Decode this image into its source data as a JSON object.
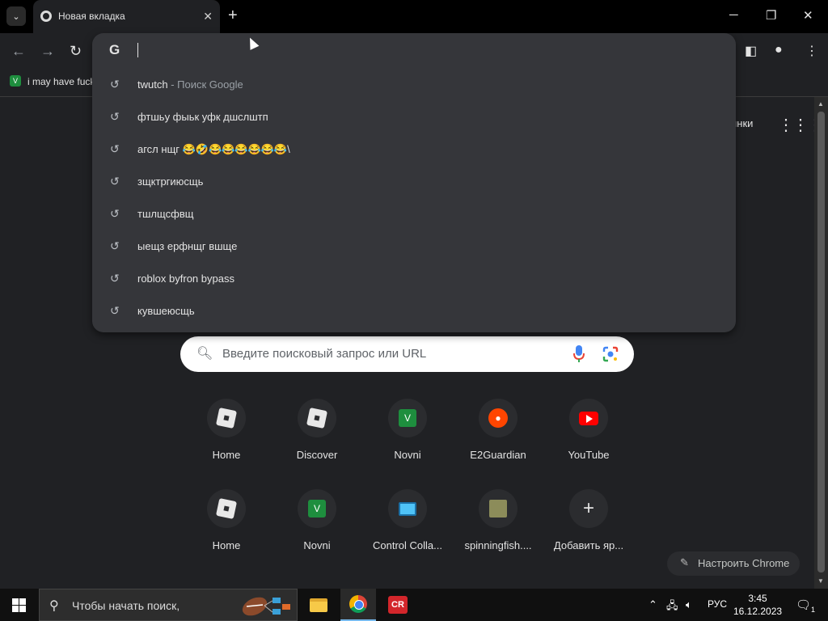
{
  "browser": {
    "tab_title": "Новая вкладка",
    "tab_close": "✕",
    "new_tab": "+",
    "window": {
      "minimize": "─",
      "restore": "❐",
      "close": "✕"
    }
  },
  "toolbar": {
    "back": "←",
    "forward": "→",
    "reload": "↻",
    "sidepanel": "◧",
    "profile": "●",
    "menu": "⋮"
  },
  "bookmarks": [
    {
      "label": "i may have fuck"
    }
  ],
  "omnibox": {
    "engine_icon": "G",
    "suggestions": [
      {
        "text": "twutch",
        "sub": " - Поиск Google"
      },
      {
        "text": "фтшьу фыьк уфк дшслштп",
        "sub": ""
      },
      {
        "text": "агсл нщг 😂🤣😂😂😂😂😂😂\\",
        "sub": ""
      },
      {
        "text": "зщктргиюсщь",
        "sub": ""
      },
      {
        "text": "тшлщсфвщ",
        "sub": ""
      },
      {
        "text": "ыещз ерфнщг вшще",
        "sub": ""
      },
      {
        "text": "roblox byfron bypass",
        "sub": ""
      },
      {
        "text": "кувшеюсщь",
        "sub": ""
      }
    ]
  },
  "ntp": {
    "images_link": "инки",
    "search_placeholder": "Введите поисковый запрос или URL",
    "shortcuts": [
      {
        "label": "Home",
        "icon": "roblox-icon"
      },
      {
        "label": "Discover",
        "icon": "roblox-icon"
      },
      {
        "label": "Novni",
        "icon": "novni-icon"
      },
      {
        "label": "E2Guardian",
        "icon": "reddit-icon"
      },
      {
        "label": "YouTube",
        "icon": "youtube-icon"
      },
      {
        "label": "Home",
        "icon": "roblox-icon"
      },
      {
        "label": "Novni",
        "icon": "novni-icon"
      },
      {
        "label": "Control Colla...",
        "icon": "monitor-icon"
      },
      {
        "label": "spinningfish....",
        "icon": "fish-icon"
      },
      {
        "label": "Добавить яр...",
        "icon": "plus-icon"
      }
    ],
    "customize_label": "Настроить Chrome"
  },
  "taskbar": {
    "search_placeholder": "Чтобы начать поиск,",
    "lang": "РУС",
    "time": "3:45",
    "date": "16.12.2023",
    "notifications": "1"
  }
}
